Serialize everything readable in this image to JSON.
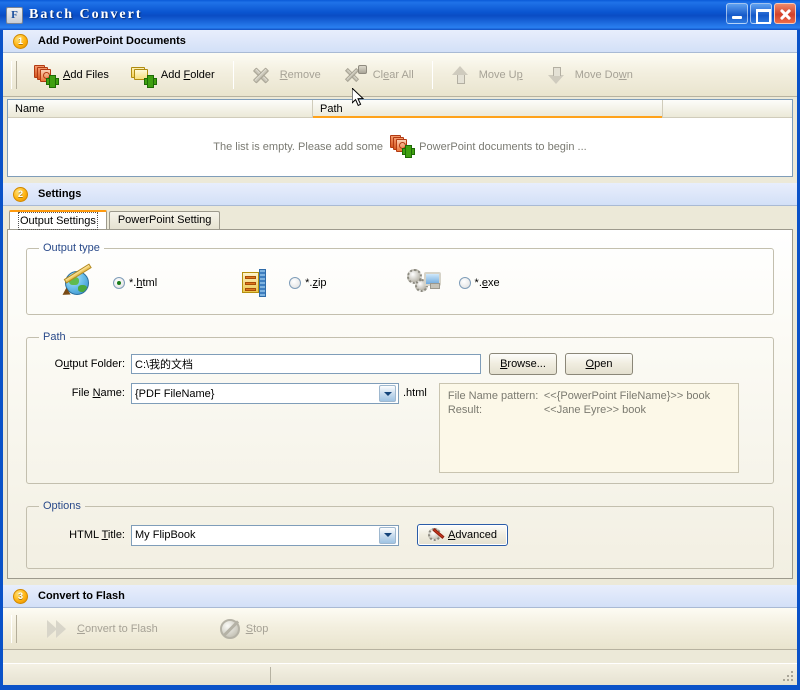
{
  "window": {
    "title": "Batch Convert",
    "icon_letter": "F",
    "buttons": {
      "minimize": "minimize-button",
      "maximize": "maximize-button",
      "close": "close-button"
    }
  },
  "step1": {
    "number": "1",
    "title": "Add PowerPoint Documents",
    "toolbar": [
      {
        "label": "Add Files",
        "icon": "add-files-icon",
        "disabled": false,
        "accel": "A"
      },
      {
        "label": "Add Folder",
        "icon": "add-folder-icon",
        "disabled": false,
        "accel": "F"
      },
      {
        "label": "Remove",
        "icon": "remove-icon",
        "disabled": true,
        "accel": "R"
      },
      {
        "label": "Clear All",
        "icon": "clear-all-icon",
        "disabled": true,
        "accel": "e"
      },
      {
        "label": "Move Up",
        "icon": "move-up-icon",
        "disabled": true,
        "accel": "p"
      },
      {
        "label": "Move Down",
        "icon": "move-down-icon",
        "disabled": true,
        "accel": "w"
      }
    ],
    "list": {
      "columns": [
        "Name",
        "Path"
      ],
      "empty_text_before": "The list is empty. Please add some",
      "empty_text_after": "PowerPoint documents to begin ...",
      "rows": []
    }
  },
  "step2": {
    "number": "2",
    "title": "Settings",
    "tabs": [
      {
        "label": "Output Settings",
        "active": true
      },
      {
        "label": "PowerPoint Setting",
        "active": false
      }
    ],
    "output_type": {
      "legend": "Output type",
      "options": [
        {
          "label": "*.html",
          "icon": "html-globe-icon",
          "selected": true
        },
        {
          "label": "*.zip",
          "icon": "zip-archive-icon",
          "selected": false
        },
        {
          "label": "*.exe",
          "icon": "exe-application-icon",
          "selected": false
        }
      ]
    },
    "path": {
      "legend": "Path",
      "output_folder_label": "Output Folder:",
      "output_folder_value": "C:\\我的文档",
      "browse_button": "Browse...",
      "open_button": "Open",
      "file_name_label": "File Name:",
      "file_name_value": "{PDF FileName}",
      "file_name_extension": ".html",
      "info": {
        "pattern_label": "File Name pattern:",
        "pattern_value": "<<{PowerPoint FileName}>> book",
        "result_label": "Result:",
        "result_value": "<<Jane Eyre>> book"
      }
    },
    "options": {
      "legend": "Options",
      "html_title_label": "HTML Title:",
      "html_title_value": "My FlipBook",
      "advanced_button": "Advanced"
    }
  },
  "step3": {
    "number": "3",
    "title": "Convert to Flash",
    "buttons": [
      {
        "label": "Convert to Flash",
        "icon": "convert-play-icon",
        "disabled": true
      },
      {
        "label": "Stop",
        "icon": "stop-icon",
        "disabled": true
      }
    ]
  },
  "statusbar": {
    "left": "",
    "right": ""
  },
  "colors": {
    "accent_orange": "#ffa21a",
    "title_blue": "#0a54cf",
    "panel": "#ece9d8",
    "step_bar": "#d3e0f7"
  }
}
